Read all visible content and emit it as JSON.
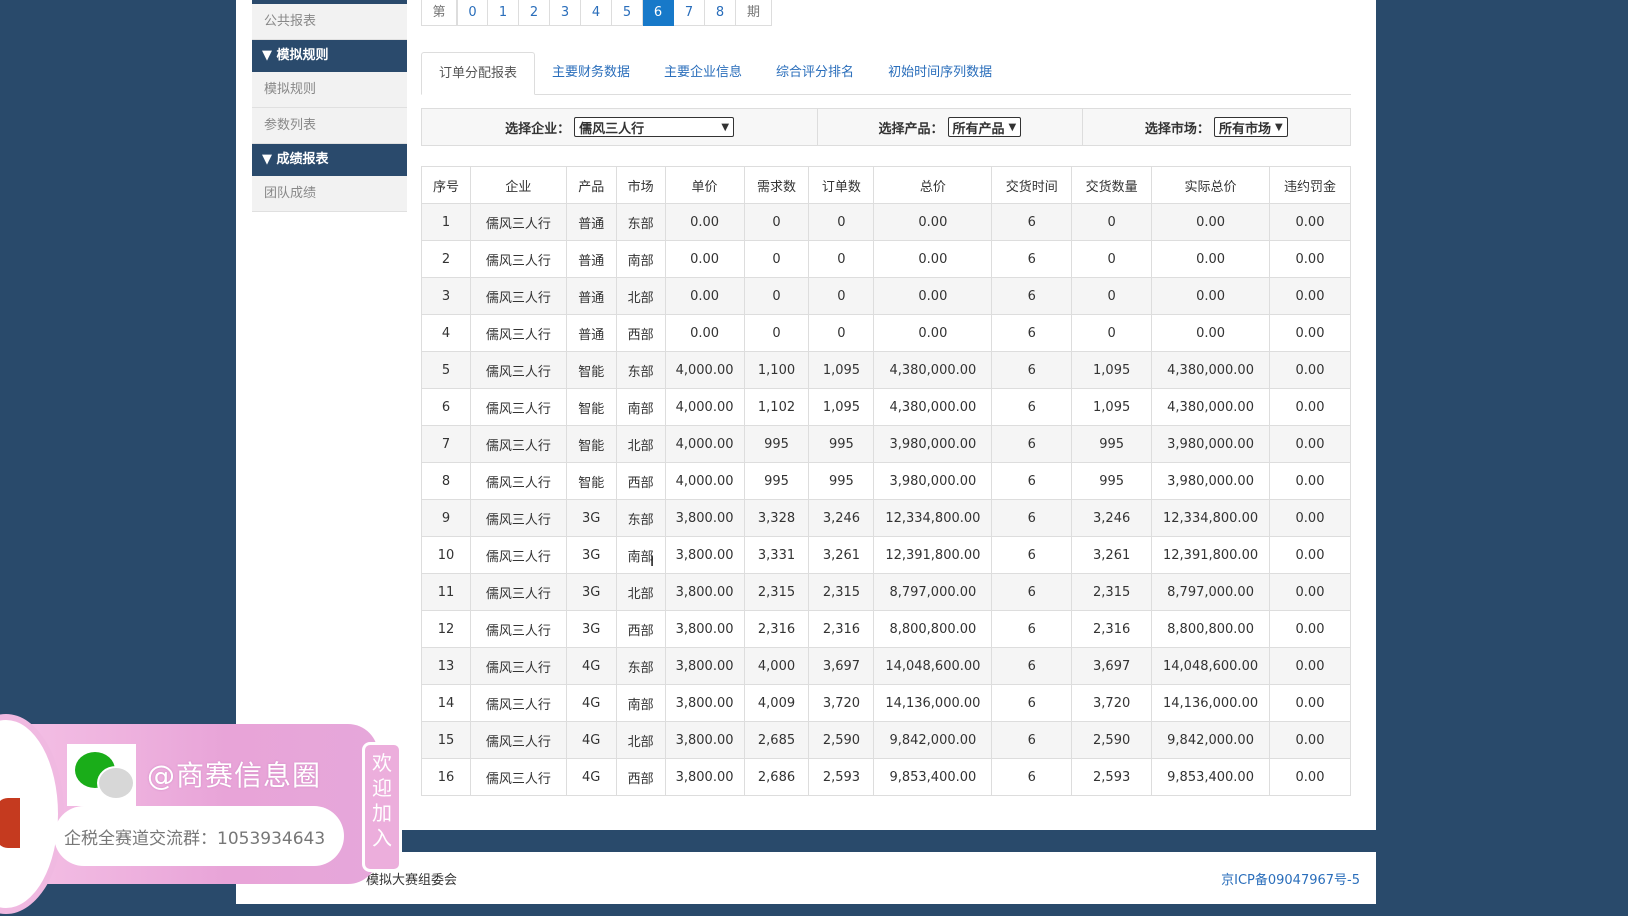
{
  "sidebar": {
    "items": [
      {
        "type": "item",
        "label": "公共报表"
      },
      {
        "type": "head",
        "label": "▼ 模拟规则"
      },
      {
        "type": "item",
        "label": "模拟规则"
      },
      {
        "type": "item",
        "label": "参数列表"
      },
      {
        "type": "head",
        "label": "▼ 成绩报表"
      },
      {
        "type": "item",
        "label": "团队成绩"
      }
    ]
  },
  "pager": {
    "prefix": "第",
    "pages": [
      "0",
      "1",
      "2",
      "3",
      "4",
      "5",
      "6",
      "7",
      "8"
    ],
    "active": "6",
    "suffix": "期"
  },
  "tabs": [
    {
      "label": "订单分配报表",
      "active": true
    },
    {
      "label": "主要财务数据",
      "active": false
    },
    {
      "label": "主要企业信息",
      "active": false
    },
    {
      "label": "综合评分排名",
      "active": false
    },
    {
      "label": "初始时间序列数据",
      "active": false
    }
  ],
  "filters": {
    "company": {
      "label": "选择企业：",
      "value": "儒风三人行"
    },
    "product": {
      "label": "选择产品：",
      "value": "所有产品"
    },
    "market": {
      "label": "选择市场：",
      "value": "所有市场"
    }
  },
  "table": {
    "headers": [
      "序号",
      "企业",
      "产品",
      "市场",
      "单价",
      "需求数",
      "订单数",
      "总价",
      "交货时间",
      "交货数量",
      "实际总价",
      "违约罚金"
    ],
    "rows": [
      [
        "1",
        "儒风三人行",
        "普通",
        "东部",
        "0.00",
        "0",
        "0",
        "0.00",
        "6",
        "0",
        "0.00",
        "0.00"
      ],
      [
        "2",
        "儒风三人行",
        "普通",
        "南部",
        "0.00",
        "0",
        "0",
        "0.00",
        "6",
        "0",
        "0.00",
        "0.00"
      ],
      [
        "3",
        "儒风三人行",
        "普通",
        "北部",
        "0.00",
        "0",
        "0",
        "0.00",
        "6",
        "0",
        "0.00",
        "0.00"
      ],
      [
        "4",
        "儒风三人行",
        "普通",
        "西部",
        "0.00",
        "0",
        "0",
        "0.00",
        "6",
        "0",
        "0.00",
        "0.00"
      ],
      [
        "5",
        "儒风三人行",
        "智能",
        "东部",
        "4,000.00",
        "1,100",
        "1,095",
        "4,380,000.00",
        "6",
        "1,095",
        "4,380,000.00",
        "0.00"
      ],
      [
        "6",
        "儒风三人行",
        "智能",
        "南部",
        "4,000.00",
        "1,102",
        "1,095",
        "4,380,000.00",
        "6",
        "1,095",
        "4,380,000.00",
        "0.00"
      ],
      [
        "7",
        "儒风三人行",
        "智能",
        "北部",
        "4,000.00",
        "995",
        "995",
        "3,980,000.00",
        "6",
        "995",
        "3,980,000.00",
        "0.00"
      ],
      [
        "8",
        "儒风三人行",
        "智能",
        "西部",
        "4,000.00",
        "995",
        "995",
        "3,980,000.00",
        "6",
        "995",
        "3,980,000.00",
        "0.00"
      ],
      [
        "9",
        "儒风三人行",
        "3G",
        "东部",
        "3,800.00",
        "3,328",
        "3,246",
        "12,334,800.00",
        "6",
        "3,246",
        "12,334,800.00",
        "0.00"
      ],
      [
        "10",
        "儒风三人行",
        "3G",
        "南部",
        "3,800.00",
        "3,331",
        "3,261",
        "12,391,800.00",
        "6",
        "3,261",
        "12,391,800.00",
        "0.00"
      ],
      [
        "11",
        "儒风三人行",
        "3G",
        "北部",
        "3,800.00",
        "2,315",
        "2,315",
        "8,797,000.00",
        "6",
        "2,315",
        "8,797,000.00",
        "0.00"
      ],
      [
        "12",
        "儒风三人行",
        "3G",
        "西部",
        "3,800.00",
        "2,316",
        "2,316",
        "8,800,800.00",
        "6",
        "2,316",
        "8,800,800.00",
        "0.00"
      ],
      [
        "13",
        "儒风三人行",
        "4G",
        "东部",
        "3,800.00",
        "4,000",
        "3,697",
        "14,048,600.00",
        "6",
        "3,697",
        "14,048,600.00",
        "0.00"
      ],
      [
        "14",
        "儒风三人行",
        "4G",
        "南部",
        "3,800.00",
        "4,009",
        "3,720",
        "14,136,000.00",
        "6",
        "3,720",
        "14,136,000.00",
        "0.00"
      ],
      [
        "15",
        "儒风三人行",
        "4G",
        "北部",
        "3,800.00",
        "2,685",
        "2,590",
        "9,842,000.00",
        "6",
        "2,590",
        "9,842,000.00",
        "0.00"
      ],
      [
        "16",
        "儒风三人行",
        "4G",
        "西部",
        "3,800.00",
        "2,686",
        "2,593",
        "9,853,400.00",
        "6",
        "2,593",
        "9,853,400.00",
        "0.00"
      ]
    ]
  },
  "footer": {
    "left": "模拟大赛组委会",
    "right": "京ICP备09047967号-5"
  },
  "overlay": {
    "icon": "wechat-icon",
    "handle": "@商赛信息圈",
    "group_text": "企税全赛道交流群：1053934643",
    "welcome": "欢迎加入"
  }
}
